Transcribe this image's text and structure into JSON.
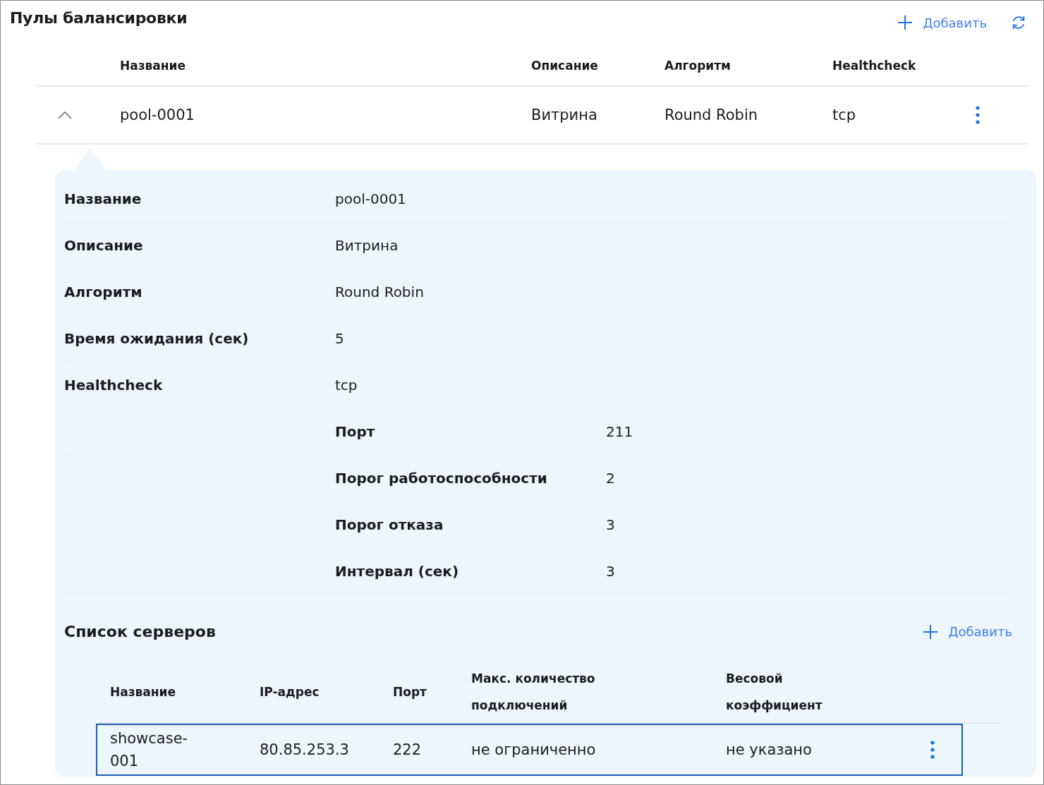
{
  "title": "Пулы балансировки",
  "toolbar": {
    "add_label": "Добавить"
  },
  "pools": {
    "columns": [
      "Название",
      "Описание",
      "Алгоритм",
      "Healthcheck"
    ],
    "rows": [
      {
        "cells": [
          "pool-0001",
          "Витрина",
          "Round Robin",
          "tcp"
        ],
        "expanded": true
      }
    ]
  },
  "details": {
    "fields": [
      {
        "label": "Название",
        "value": "pool-0001"
      },
      {
        "label": "Описание",
        "value": "Витрина"
      },
      {
        "label": "Алгоритм",
        "value": "Round Robin"
      },
      {
        "label": "Время ожидания (сек)",
        "value": "5"
      },
      {
        "label": "Healthcheck",
        "value": "tcp"
      }
    ],
    "healthcheck_fields": [
      {
        "label": "Порт",
        "value": "211"
      },
      {
        "label": "Порог работоспособности",
        "value": "2"
      },
      {
        "label": "Порог отказа",
        "value": "3"
      },
      {
        "label": "Интервал (сек)",
        "value": "3"
      }
    ]
  },
  "servers": {
    "title": "Список серверов",
    "add_label": "Добавить",
    "columns": [
      "Название",
      "IP-адрес",
      "Порт",
      "Макс. количество подключений",
      "Весовой коэффициент"
    ],
    "rows": [
      {
        "cells": [
          "showcase-001",
          "80.85.253.3",
          "222",
          "не ограниченно",
          "не указано"
        ],
        "selected": true
      }
    ]
  }
}
